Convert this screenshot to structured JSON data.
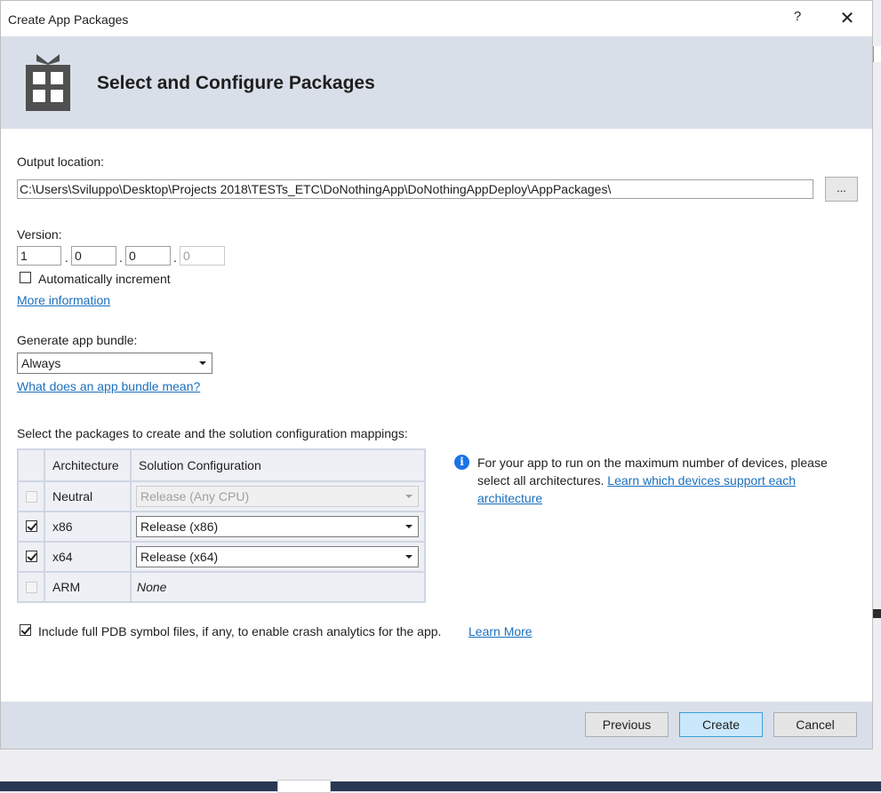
{
  "window": {
    "title": "Create App Packages",
    "help_glyph": "?",
    "close_glyph": "✕"
  },
  "header": {
    "title": "Select and Configure Packages",
    "icon": "package-grid-icon"
  },
  "output": {
    "label": "Output location:",
    "path": "C:\\Users\\Sviluppo\\Desktop\\Projects 2018\\TESTs_ETC\\DoNothingApp\\DoNothingAppDeploy\\AppPackages\\",
    "browse_label": "..."
  },
  "version": {
    "label": "Version:",
    "parts": [
      "1",
      "0",
      "0",
      "0"
    ],
    "separator": ".",
    "auto_increment_label": "Automatically increment",
    "auto_increment_checked": false,
    "more_info_link": "More information"
  },
  "bundle": {
    "label": "Generate app bundle:",
    "selected": "Always",
    "link": "What does an app bundle mean?"
  },
  "packages": {
    "label": "Select the packages to create and the solution configuration mappings:",
    "columns": [
      "Architecture",
      "Solution Configuration"
    ],
    "rows": [
      {
        "arch": "Neutral",
        "config": "Release (Any CPU)",
        "checked": false,
        "enabled": false
      },
      {
        "arch": "x86",
        "config": "Release (x86)",
        "checked": true,
        "enabled": true
      },
      {
        "arch": "x64",
        "config": "Release (x64)",
        "checked": true,
        "enabled": true
      },
      {
        "arch": "ARM",
        "config": "None",
        "checked": false,
        "enabled": false
      }
    ]
  },
  "info": {
    "text": "For your app to run on the maximum number of devices, please select all architectures.",
    "link": "Learn which devices support each architecture"
  },
  "pdb": {
    "label": "Include full PDB symbol files, if any, to enable crash analytics for the app.",
    "checked": true,
    "link": "Learn More"
  },
  "footer": {
    "previous": "Previous",
    "create": "Create",
    "cancel": "Cancel"
  },
  "colors": {
    "header_bg": "#d9dfe9",
    "link": "#1a6fbd",
    "primary_button": "#c9e8fb",
    "info_icon": "#1a73e8"
  }
}
